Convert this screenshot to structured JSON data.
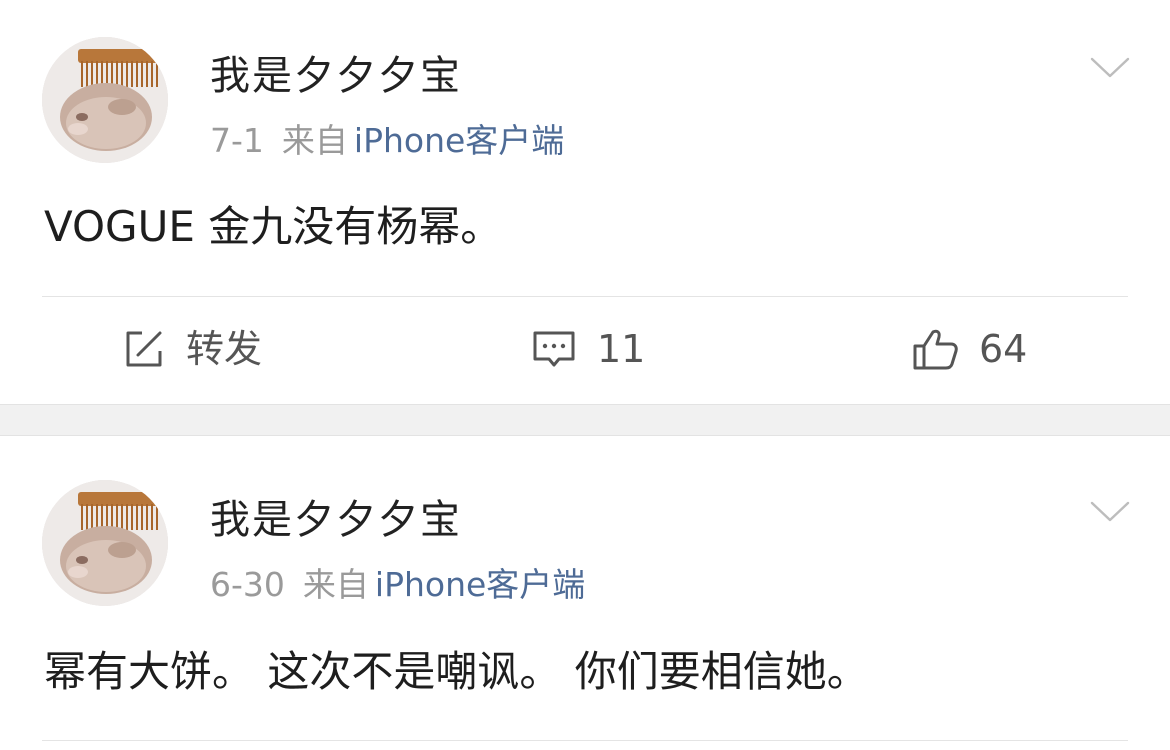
{
  "posts": [
    {
      "user": "我是夕夕夕宝",
      "date": "7-1",
      "from_label": "来自",
      "source": "iPhone客户端",
      "text": "VOGUE 金九没有杨幂。",
      "actions": {
        "repost_label": "转发",
        "comment_count": "11",
        "like_count": "64"
      }
    },
    {
      "user": "我是夕夕夕宝",
      "date": "6-30",
      "from_label": "来自",
      "source": "iPhone客户端",
      "text": "幂有大饼。 这次不是嘲讽。 你们要相信她。"
    }
  ],
  "icons": {
    "repost": "compose-icon",
    "comment": "comment-icon",
    "like": "thumbs-up-icon",
    "menu": "chevron-down-icon"
  },
  "colors": {
    "link": "#4e6b96",
    "meta": "#9a9a9a",
    "separator_band": "#f1f1f1"
  }
}
